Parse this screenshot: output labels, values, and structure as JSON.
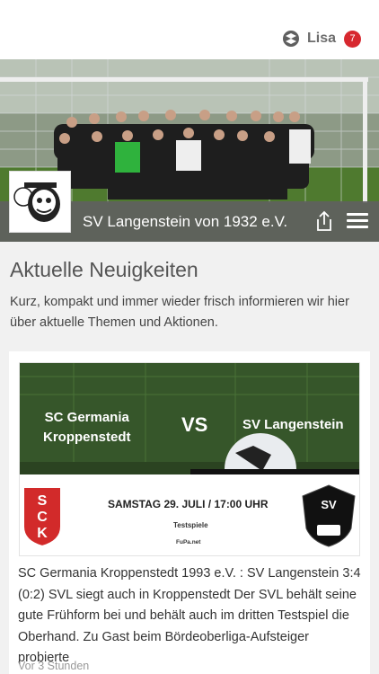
{
  "header": {
    "user_name": "Lisa",
    "notification_count": "7"
  },
  "hero": {
    "club_name": "SV Langenstein von 1932 e.V."
  },
  "news": {
    "title": "Aktuelle Neuigkeiten",
    "subtitle": "Kurz, kompakt und immer wieder frisch informieren wir hier über aktuelle Themen und Aktionen."
  },
  "article": {
    "banner": {
      "team_a_line1": "SC Germania",
      "team_a_line2": "Kroppenstedt",
      "vs": "VS",
      "team_b": "SV Langenstein",
      "date": "SAMSTAG 29. JULI / 17:00 UHR",
      "type": "Testspiele",
      "source": "FuPa.net"
    },
    "text": "SC Germania Kroppenstedt 1993 e.V. : SV Langenstein 3:4 (0:2) SVL siegt auch in Kroppenstedt Der SVL behält seine gute Frühform bei und behält auch im dritten Testspiel die Oberhand. Zu Gast beim Bördeoberliga-Aufsteiger probierte",
    "time": "Vor 3 Stunden"
  }
}
